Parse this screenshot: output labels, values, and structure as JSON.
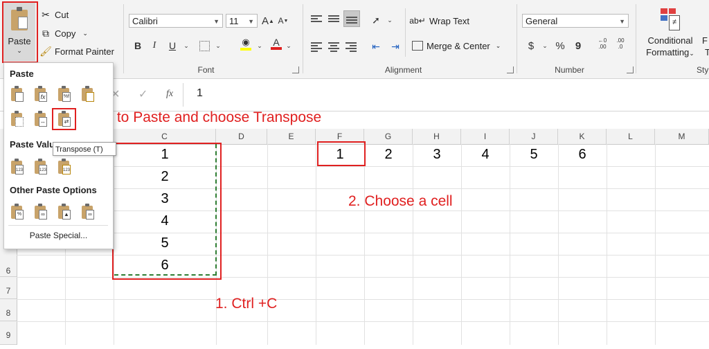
{
  "ribbon": {
    "clipboard": {
      "paste": "Paste",
      "cut": "Cut",
      "copy": "Copy",
      "format_painter": "Format Painter"
    },
    "font": {
      "name": "Calibri",
      "size": "11",
      "group_label": "Font",
      "bold": "B",
      "italic": "I",
      "underline": "U",
      "grow": "A",
      "shrink": "A"
    },
    "alignment": {
      "wrap_text": "Wrap Text",
      "merge_center": "Merge & Center",
      "group_label": "Alignment"
    },
    "number": {
      "format": "General",
      "currency": "$",
      "percent": "%",
      "comma": "9",
      "inc_decimal": ".00",
      "dec_decimal": ".0",
      "group_label": "Number"
    },
    "styles": {
      "conditional_l1": "Conditional",
      "conditional_l2": "Formatting",
      "format_l1": "F",
      "format_l2": "T",
      "group_label": "Sty"
    }
  },
  "formula_bar": {
    "fx": "fx",
    "value": "1"
  },
  "paste_menu": {
    "section_paste": "Paste",
    "section_values": "Paste Valu",
    "section_other": "Other Paste Options",
    "paste_special": "Paste Special...",
    "tooltip": "Transpose (T)",
    "values_icon_label": "123"
  },
  "columns": [
    "C",
    "D",
    "E",
    "F",
    "G",
    "H",
    "I",
    "J",
    "K",
    "L",
    "M"
  ],
  "rows": [
    "6",
    "7",
    "8",
    "9"
  ],
  "column_c_values": [
    "1",
    "2",
    "3",
    "4",
    "5",
    "6"
  ],
  "row_values": [
    "1",
    "2",
    "3",
    "4",
    "5",
    "6"
  ],
  "annotations": {
    "transpose": "Go to Paste and choose Transpose",
    "choose_cell": "2. Choose a cell",
    "ctrl_c": "1. Ctrl +C"
  },
  "colors": {
    "annotation": "#e02020",
    "copy_marquee": "#2e7d32"
  }
}
